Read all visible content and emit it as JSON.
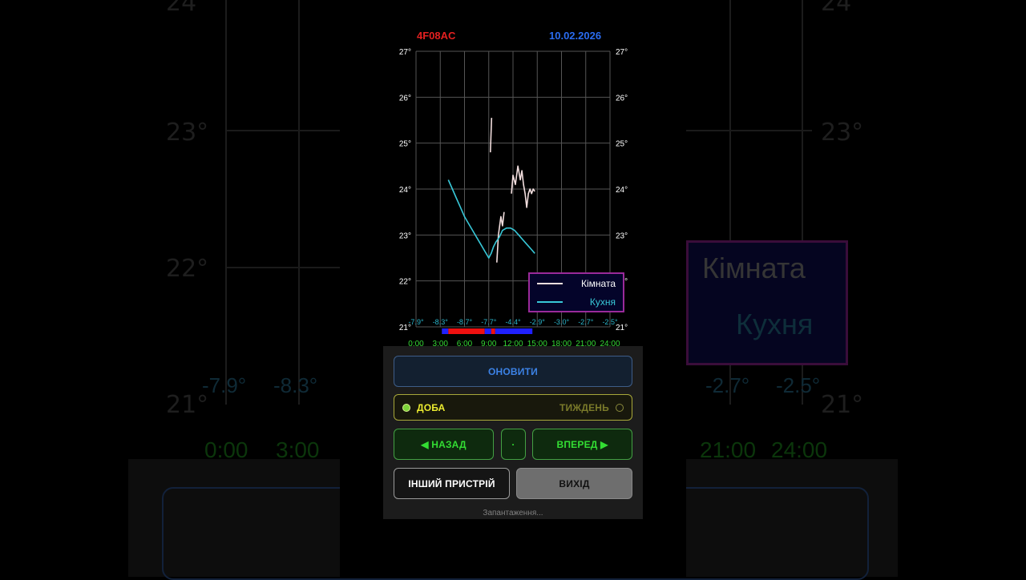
{
  "header": {
    "device_id": "4F08AC",
    "date": "10.02.2026"
  },
  "chart_data": {
    "type": "line",
    "x_ticks": [
      "0:00",
      "3:00",
      "6:00",
      "9:00",
      "12:00",
      "15:00",
      "18:00",
      "21:00",
      "24:00"
    ],
    "x_range_hours": [
      0,
      24
    ],
    "y_ticks_left": [
      "21°",
      "22°",
      "23°",
      "24°",
      "25°",
      "26°",
      "27°"
    ],
    "y_ticks_right": [
      "21°",
      "22°",
      "23°",
      "24°",
      "25°",
      "26°",
      "27°"
    ],
    "ylim": [
      21,
      27
    ],
    "grid": true,
    "outdoor_temps": [
      "-7.9°",
      "-8.3°",
      "-8.7°",
      "-7.7°",
      "-4.4°",
      "-2.9°",
      "-3.0°",
      "-2.7°",
      "-2.5°"
    ],
    "legend": {
      "placement": "bottom-right",
      "items": [
        "Кімната",
        "Кухня"
      ]
    },
    "series": [
      {
        "name": "Кімната",
        "color": "#f2dede",
        "points": [
          [
            9.2,
            24.8
          ],
          [
            9.35,
            25.55
          ],
          [
            10.0,
            22.4
          ],
          [
            10.2,
            23.0
          ],
          [
            10.5,
            23.4
          ],
          [
            10.7,
            23.2
          ],
          [
            10.9,
            23.5
          ],
          [
            11.8,
            23.9
          ],
          [
            12.0,
            24.3
          ],
          [
            12.3,
            24.1
          ],
          [
            12.6,
            24.5
          ],
          [
            12.9,
            24.2
          ],
          [
            13.1,
            24.4
          ],
          [
            13.3,
            24.1
          ],
          [
            13.5,
            23.9
          ],
          [
            13.7,
            23.6
          ],
          [
            13.9,
            23.9
          ],
          [
            14.1,
            24.0
          ],
          [
            14.3,
            23.9
          ],
          [
            14.5,
            24.0
          ],
          [
            14.7,
            23.95
          ]
        ]
      },
      {
        "name": "Кухня",
        "color": "#38c8d8",
        "points": [
          [
            4.0,
            24.2
          ],
          [
            4.5,
            24.0
          ],
          [
            5.0,
            23.8
          ],
          [
            5.5,
            23.6
          ],
          [
            6.0,
            23.4
          ],
          [
            6.5,
            23.25
          ],
          [
            7.0,
            23.1
          ],
          [
            7.5,
            22.95
          ],
          [
            8.0,
            22.8
          ],
          [
            8.5,
            22.65
          ],
          [
            9.0,
            22.5
          ],
          [
            9.3,
            22.6
          ],
          [
            9.6,
            22.75
          ],
          [
            9.9,
            22.85
          ],
          [
            10.3,
            22.95
          ],
          [
            10.7,
            23.1
          ],
          [
            11.2,
            23.15
          ],
          [
            11.7,
            23.15
          ],
          [
            12.2,
            23.1
          ],
          [
            12.7,
            23.0
          ],
          [
            13.2,
            22.9
          ],
          [
            13.7,
            22.8
          ],
          [
            14.2,
            22.7
          ],
          [
            14.7,
            22.6
          ]
        ]
      }
    ],
    "activity_bar": [
      {
        "from": 3.2,
        "to": 4.0,
        "color": "#2020ff"
      },
      {
        "from": 4.0,
        "to": 8.5,
        "color": "#ee1010"
      },
      {
        "from": 8.5,
        "to": 9.3,
        "color": "#2020ff"
      },
      {
        "from": 9.3,
        "to": 9.8,
        "color": "#ee1010"
      },
      {
        "from": 9.8,
        "to": 14.4,
        "color": "#2020ff"
      }
    ]
  },
  "controls": {
    "refresh_label": "ОНОВИТИ",
    "period_day_label": "ДОБА",
    "period_week_label": "ТИЖДЕНЬ",
    "selected_period": "day",
    "back_label": "◀ НАЗАД",
    "dot_label": "·",
    "forward_label": "ВПЕРЕД ▶",
    "other_device_label": "ІНШИЙ ПРИСТРІЙ",
    "exit_label": "ВИХІД"
  },
  "status_text": "Запантаження...",
  "background": {
    "y_labels": [
      "24°",
      "23°",
      "22°",
      "21°"
    ],
    "legend_items": [
      "Кімната",
      "Кухня"
    ],
    "times": [
      "0:00",
      "3:00",
      "21:00",
      "24:00"
    ],
    "offsets": [
      "-7.9°",
      "-8.3°",
      "-2.7°",
      "-2.5°"
    ]
  }
}
